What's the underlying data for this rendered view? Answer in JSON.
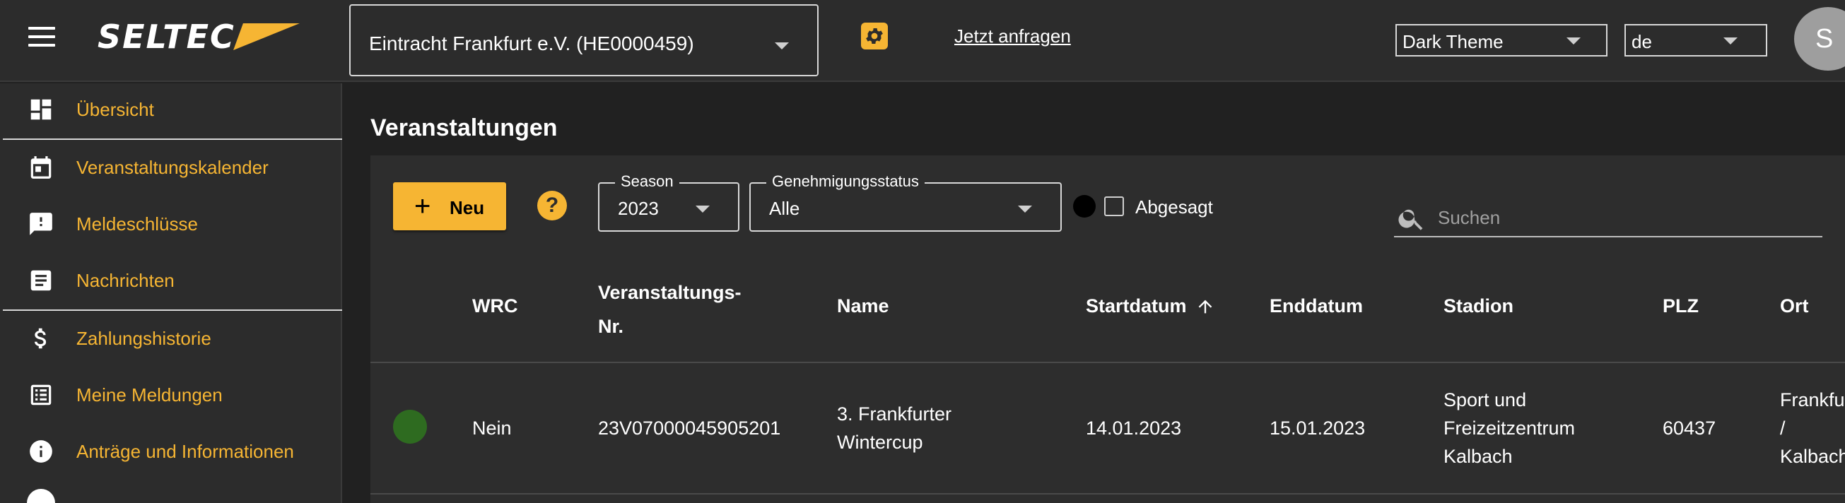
{
  "header": {
    "brand": "SELTEC",
    "club_select_value": "Eintracht Frankfurt e.V. (HE0000459)",
    "request_link": "Jetzt anfragen",
    "theme_select_value": "Dark Theme",
    "language_select_value": "de",
    "avatar_initial": "S"
  },
  "sidebar": {
    "items": [
      {
        "label": "Übersicht",
        "icon": "dashboard-icon"
      },
      {
        "label": "Veranstaltungskalender",
        "icon": "calendar-icon"
      },
      {
        "label": "Meldeschlüsse",
        "icon": "feedback-icon"
      },
      {
        "label": "Nachrichten",
        "icon": "article-icon"
      },
      {
        "label": "Zahlungshistorie",
        "icon": "dollar-icon"
      },
      {
        "label": "Meine Meldungen",
        "icon": "list-icon"
      },
      {
        "label": "Anträge und Informationen",
        "icon": "info-icon"
      }
    ]
  },
  "main": {
    "title": "Veranstaltungen",
    "new_button": "Neu",
    "season": {
      "legend": "Season",
      "value": "2023"
    },
    "approval_status": {
      "legend": "Genehmigungsstatus",
      "value": "Alle"
    },
    "cancelled_label": "Abgesagt",
    "search_placeholder": "Suchen",
    "columns": {
      "wrc": "WRC",
      "event_no_line1": "Veranstaltungs-",
      "event_no_line2": "Nr.",
      "name": "Name",
      "start": "Startdatum",
      "end": "Enddatum",
      "stadium": "Stadion",
      "zip": "PLZ",
      "city": "Ort"
    },
    "rows": [
      {
        "wrc": "Nein",
        "event_no": "23V07000045905201",
        "name_line1": "3. Frankfurter",
        "name_line2": "Wintercup",
        "start": "14.01.2023",
        "end": "15.01.2023",
        "stadium_line1": "Sport und",
        "stadium_line2": "Freizeitzentrum",
        "stadium_line3": "Kalbach",
        "zip": "60437",
        "city_line1": "Frankfurt",
        "city_line2": "/",
        "city_line3": "Kalbach",
        "status_color": "#2e6b20"
      }
    ]
  },
  "colors": {
    "accent": "#f6b533",
    "background": "#212121",
    "surface": "#2d2d2d"
  }
}
